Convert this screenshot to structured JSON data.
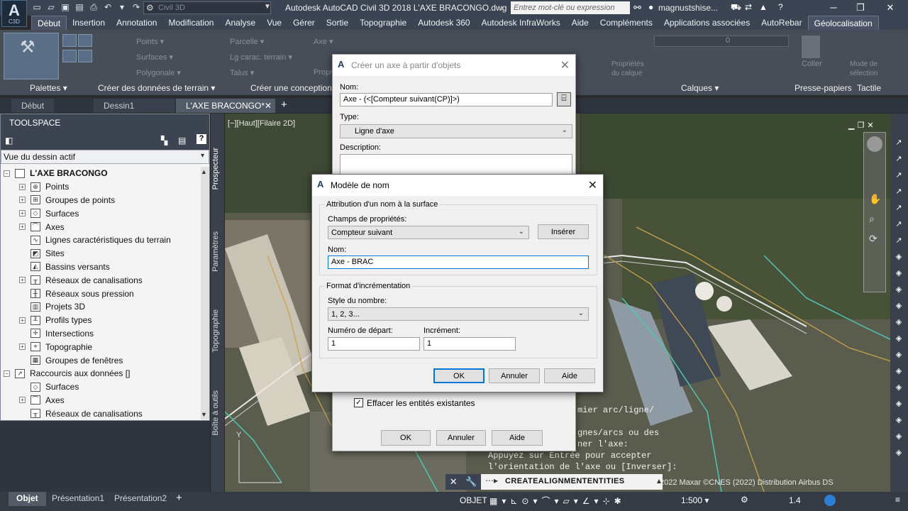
{
  "app": {
    "badge": "C3D",
    "workspace": "Civil 3D",
    "window_title": "Autodesk AutoCAD Civil 3D 2018   L'AXE BRACONGO.dwg",
    "search_placeholder": "Entrez mot-clé ou expression",
    "user": "magnustshise..."
  },
  "menu": [
    "Début",
    "Insertion",
    "Annotation",
    "Modification",
    "Analyse",
    "Vue",
    "Gérer",
    "Sortie",
    "Topographie",
    "Autodesk 360",
    "Autodesk InfraWorks",
    "Aide",
    "Compléments",
    "Applications associées",
    "AutoRebar",
    "Géolocalisation"
  ],
  "ribbon": {
    "panels": [
      "Palettes ▾",
      "Créer des données de terrain ▾",
      "Créer une conception ▾",
      "Calques ▾",
      "Presse-papiers",
      "Tactile"
    ],
    "items": [
      "Points ▾",
      "Surfaces ▾",
      "Polygonale ▾",
      "Parcelle ▾",
      "Lg carac. terrain ▾",
      "Talus ▾",
      "Axe ▾",
      "Propr...",
      "Propriétés du calque",
      "Coller",
      "Mode de sélection"
    ],
    "layer_combo": "0"
  },
  "file_tabs": [
    "Début",
    "Dessin1",
    "L'AXE BRACONGO*"
  ],
  "toolspace": {
    "title": "TOOLSPACE",
    "view": "Vue du dessin actif",
    "root": "L'AXE BRACONGO",
    "items": [
      "Points",
      "Groupes de points",
      "Surfaces",
      "Axes",
      "Lignes caractéristiques du terrain",
      "Sites",
      "Bassins versants",
      "Réseaux de canalisations",
      "Réseaux sous pression",
      "Projets 3D",
      "Profils types",
      "Intersections",
      "Topographie",
      "Groupes de fenêtres"
    ],
    "shortcuts": "Raccourcis aux données []",
    "shortcut_items": [
      "Surfaces",
      "Axes",
      "Réseaux de canalisations"
    ],
    "side_tabs": [
      "Prospecteur",
      "Paramètres",
      "Topographie",
      "Boîte à outils"
    ]
  },
  "viewport": {
    "label": "[−][Haut][Filaire 2D]",
    "copyright": "2022 Maxar ©CNES (2022) Distribution Airbus DS"
  },
  "command": {
    "history": [
      "mier arc/ligne/",
      "gnes/arcs ou des",
      "ner l'axe:",
      "Appuyez sur Entrée pour accepter",
      "l'orientation de l'axe ou [Inverser]:"
    ],
    "input": "CREATEALIGNMENTENTITIES"
  },
  "layout_tabs": [
    "Objet",
    "Présentation1",
    "Présentation2"
  ],
  "status": {
    "model": "OBJET",
    "scale": "1:500 ▾",
    "value": "1.4"
  },
  "dialog_create": {
    "title": "Créer un axe à partir d'objets",
    "name_label": "Nom:",
    "name_value": "Axe - (<[Compteur suivant(CP)]>)",
    "type_label": "Type:",
    "type_value": "Ligne d'axe",
    "desc_label": "Description:",
    "erase_label": "Effacer les entités existantes",
    "ok": "OK",
    "cancel": "Annuler",
    "help": "Aide"
  },
  "dialog_name": {
    "title": "Modèle de nom",
    "group1": "Attribution d'un nom à la surface",
    "fields_label": "Champs de propriétés:",
    "fields_value": "Compteur suivant",
    "insert": "Insérer",
    "name_label": "Nom:",
    "name_value": "Axe - BRAC",
    "group2": "Format d'incrémentation",
    "style_label": "Style du nombre:",
    "style_value": "1, 2, 3...",
    "start_label": "Numéro de départ:",
    "start_value": "1",
    "incr_label": "Incrément:",
    "incr_value": "1",
    "ok": "OK",
    "cancel": "Annuler",
    "help": "Aide"
  }
}
